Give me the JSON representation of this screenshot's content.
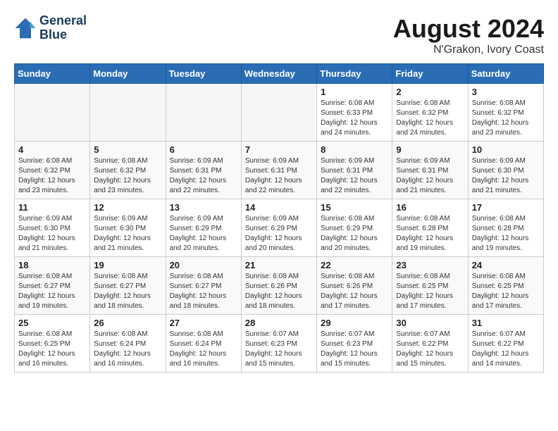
{
  "header": {
    "logo_line1": "General",
    "logo_line2": "Blue",
    "month_year": "August 2024",
    "location": "N'Grakon, Ivory Coast"
  },
  "weekdays": [
    "Sunday",
    "Monday",
    "Tuesday",
    "Wednesday",
    "Thursday",
    "Friday",
    "Saturday"
  ],
  "weeks": [
    [
      {
        "day": "",
        "info": ""
      },
      {
        "day": "",
        "info": ""
      },
      {
        "day": "",
        "info": ""
      },
      {
        "day": "",
        "info": ""
      },
      {
        "day": "1",
        "info": "Sunrise: 6:08 AM\nSunset: 6:33 PM\nDaylight: 12 hours and 24 minutes."
      },
      {
        "day": "2",
        "info": "Sunrise: 6:08 AM\nSunset: 6:32 PM\nDaylight: 12 hours and 24 minutes."
      },
      {
        "day": "3",
        "info": "Sunrise: 6:08 AM\nSunset: 6:32 PM\nDaylight: 12 hours and 23 minutes."
      }
    ],
    [
      {
        "day": "4",
        "info": "Sunrise: 6:08 AM\nSunset: 6:32 PM\nDaylight: 12 hours and 23 minutes."
      },
      {
        "day": "5",
        "info": "Sunrise: 6:08 AM\nSunset: 6:32 PM\nDaylight: 12 hours and 23 minutes."
      },
      {
        "day": "6",
        "info": "Sunrise: 6:09 AM\nSunset: 6:31 PM\nDaylight: 12 hours and 22 minutes."
      },
      {
        "day": "7",
        "info": "Sunrise: 6:09 AM\nSunset: 6:31 PM\nDaylight: 12 hours and 22 minutes."
      },
      {
        "day": "8",
        "info": "Sunrise: 6:09 AM\nSunset: 6:31 PM\nDaylight: 12 hours and 22 minutes."
      },
      {
        "day": "9",
        "info": "Sunrise: 6:09 AM\nSunset: 6:31 PM\nDaylight: 12 hours and 21 minutes."
      },
      {
        "day": "10",
        "info": "Sunrise: 6:09 AM\nSunset: 6:30 PM\nDaylight: 12 hours and 21 minutes."
      }
    ],
    [
      {
        "day": "11",
        "info": "Sunrise: 6:09 AM\nSunset: 6:30 PM\nDaylight: 12 hours and 21 minutes."
      },
      {
        "day": "12",
        "info": "Sunrise: 6:09 AM\nSunset: 6:30 PM\nDaylight: 12 hours and 21 minutes."
      },
      {
        "day": "13",
        "info": "Sunrise: 6:09 AM\nSunset: 6:29 PM\nDaylight: 12 hours and 20 minutes."
      },
      {
        "day": "14",
        "info": "Sunrise: 6:09 AM\nSunset: 6:29 PM\nDaylight: 12 hours and 20 minutes."
      },
      {
        "day": "15",
        "info": "Sunrise: 6:08 AM\nSunset: 6:29 PM\nDaylight: 12 hours and 20 minutes."
      },
      {
        "day": "16",
        "info": "Sunrise: 6:08 AM\nSunset: 6:28 PM\nDaylight: 12 hours and 19 minutes."
      },
      {
        "day": "17",
        "info": "Sunrise: 6:08 AM\nSunset: 6:28 PM\nDaylight: 12 hours and 19 minutes."
      }
    ],
    [
      {
        "day": "18",
        "info": "Sunrise: 6:08 AM\nSunset: 6:27 PM\nDaylight: 12 hours and 19 minutes."
      },
      {
        "day": "19",
        "info": "Sunrise: 6:08 AM\nSunset: 6:27 PM\nDaylight: 12 hours and 18 minutes."
      },
      {
        "day": "20",
        "info": "Sunrise: 6:08 AM\nSunset: 6:27 PM\nDaylight: 12 hours and 18 minutes."
      },
      {
        "day": "21",
        "info": "Sunrise: 6:08 AM\nSunset: 6:26 PM\nDaylight: 12 hours and 18 minutes."
      },
      {
        "day": "22",
        "info": "Sunrise: 6:08 AM\nSunset: 6:26 PM\nDaylight: 12 hours and 17 minutes."
      },
      {
        "day": "23",
        "info": "Sunrise: 6:08 AM\nSunset: 6:25 PM\nDaylight: 12 hours and 17 minutes."
      },
      {
        "day": "24",
        "info": "Sunrise: 6:08 AM\nSunset: 6:25 PM\nDaylight: 12 hours and 17 minutes."
      }
    ],
    [
      {
        "day": "25",
        "info": "Sunrise: 6:08 AM\nSunset: 6:25 PM\nDaylight: 12 hours and 16 minutes."
      },
      {
        "day": "26",
        "info": "Sunrise: 6:08 AM\nSunset: 6:24 PM\nDaylight: 12 hours and 16 minutes."
      },
      {
        "day": "27",
        "info": "Sunrise: 6:08 AM\nSunset: 6:24 PM\nDaylight: 12 hours and 16 minutes."
      },
      {
        "day": "28",
        "info": "Sunrise: 6:07 AM\nSunset: 6:23 PM\nDaylight: 12 hours and 15 minutes."
      },
      {
        "day": "29",
        "info": "Sunrise: 6:07 AM\nSunset: 6:23 PM\nDaylight: 12 hours and 15 minutes."
      },
      {
        "day": "30",
        "info": "Sunrise: 6:07 AM\nSunset: 6:22 PM\nDaylight: 12 hours and 15 minutes."
      },
      {
        "day": "31",
        "info": "Sunrise: 6:07 AM\nSunset: 6:22 PM\nDaylight: 12 hours and 14 minutes."
      }
    ]
  ]
}
